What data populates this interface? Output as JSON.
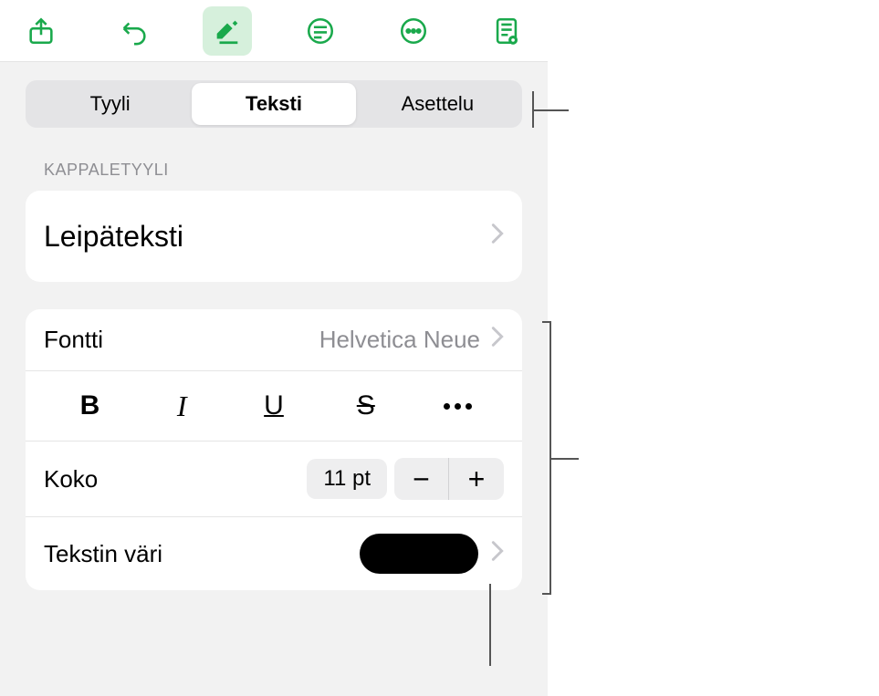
{
  "toolbar": {
    "icons": [
      "share",
      "undo",
      "format",
      "insert",
      "more",
      "document"
    ]
  },
  "tabs": {
    "style": "Tyyli",
    "text": "Teksti",
    "layout": "Asettelu"
  },
  "paragraph_style": {
    "header": "Kappaletyyli",
    "value": "Leipäteksti"
  },
  "font": {
    "label": "Fontti",
    "value": "Helvetica Neue"
  },
  "style_buttons": {
    "bold": "B",
    "italic": "I",
    "underline": "U",
    "strike": "S"
  },
  "size": {
    "label": "Koko",
    "value": "11 pt",
    "minus": "−",
    "plus": "+"
  },
  "text_color": {
    "label": "Tekstin väri",
    "value": "#000000"
  }
}
